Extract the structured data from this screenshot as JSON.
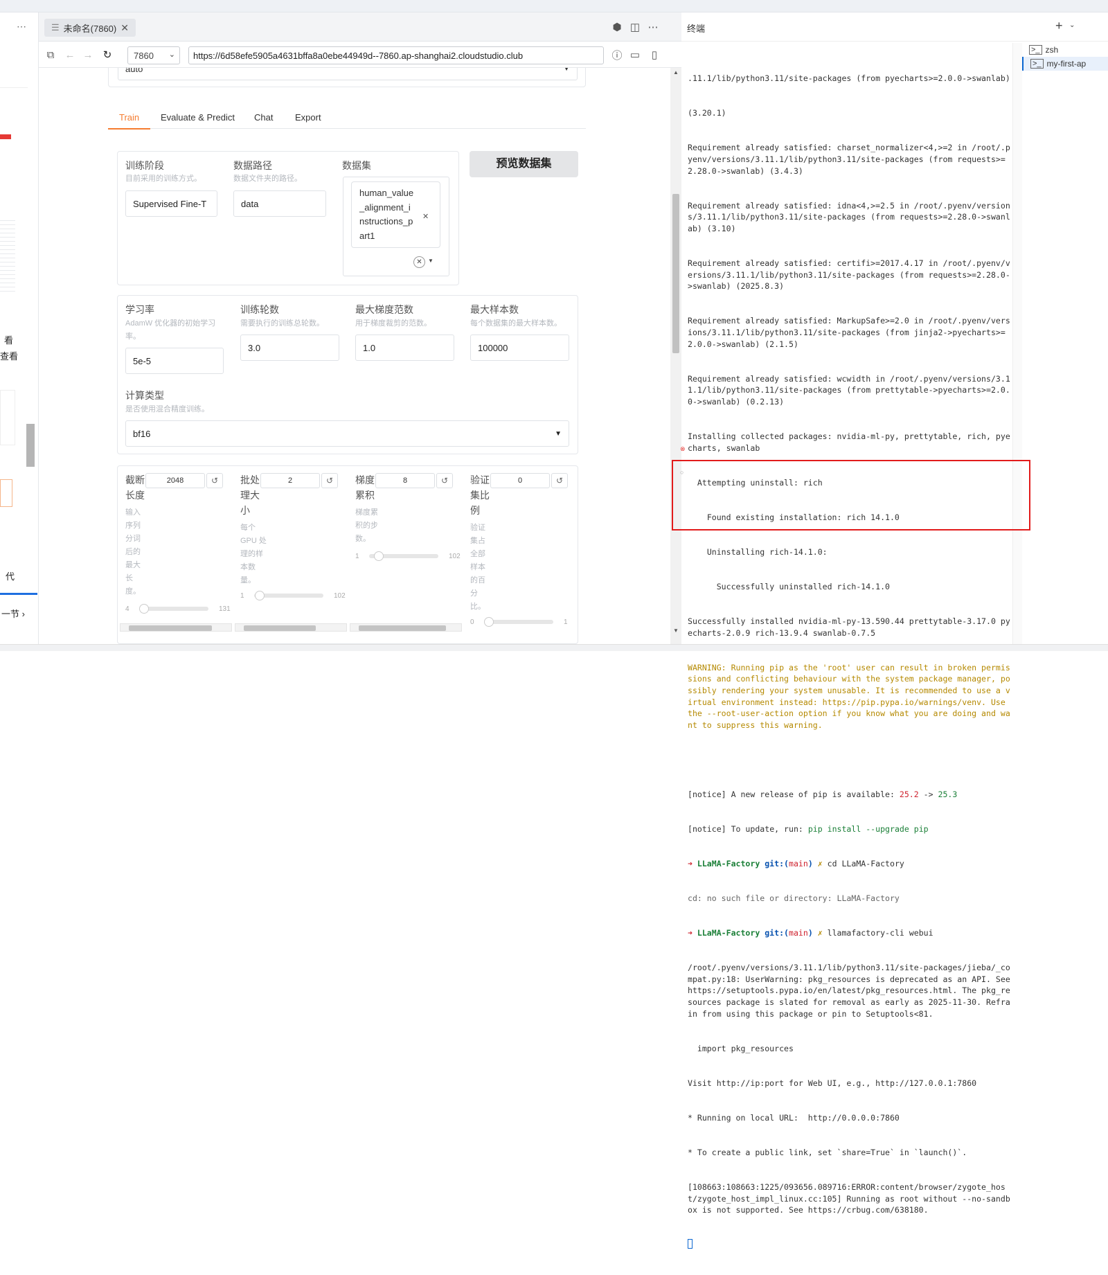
{
  "browser": {
    "tab_title": "未命名(7860)",
    "port": "7860",
    "url": "https://6d58efe5905a4631bffa8a0ebe44949d--7860.ap-shanghai2.cloudstudio.club"
  },
  "webui": {
    "top_select_value": "auto",
    "tabs": [
      "Train",
      "Evaluate & Predict",
      "Chat",
      "Export"
    ],
    "active_tab": "Train",
    "stage": {
      "label": "训练阶段",
      "hint": "目前采用的训练方式。",
      "value": "Supervised Fine-T"
    },
    "dataset_dir": {
      "label": "数据路径",
      "hint": "数据文件夹的路径。",
      "value": "data"
    },
    "dataset": {
      "label": "数据集",
      "chip": [
        "human_value",
        "_alignment_i",
        "nstructions_p",
        "art1"
      ]
    },
    "preview_button": "预览数据集",
    "learning_rate": {
      "label": "学习率",
      "hint": [
        "AdamW 优化器的初始学习",
        "率。"
      ],
      "value": "5e-5"
    },
    "epochs": {
      "label": "训练轮数",
      "hint": "需要执行的训练总轮数。",
      "value": "3.0"
    },
    "max_grad_norm": {
      "label": "最大梯度范数",
      "hint": "用于梯度裁剪的范数。",
      "value": "1.0"
    },
    "max_samples": {
      "label": "最大样本数",
      "hint": "每个数据集的最大样本数。",
      "value": "100000"
    },
    "compute_type": {
      "label": "计算类型",
      "hint": "是否使用混合精度训练。",
      "value": "bf16"
    },
    "cutoff_len": {
      "label": [
        "截断",
        "长度"
      ],
      "hint": [
        "输入",
        "序列",
        "分词",
        "后的",
        "最大",
        "长",
        "度。"
      ],
      "value": "2048",
      "min": "4",
      "max": "131",
      "level": 0.0
    },
    "batch_size": {
      "label": [
        "批处",
        "理大",
        "小"
      ],
      "hint": [
        "每个",
        "GPU 处",
        "理的样",
        "本数",
        "量。"
      ],
      "value": "2",
      "min": "1",
      "max": "102",
      "level": 0.01
    },
    "grad_accum": {
      "label": [
        "梯度",
        "累积"
      ],
      "hint": [
        "梯度累",
        "积的步",
        "数。"
      ],
      "value": "8",
      "min": "1",
      "max": "102",
      "level": 0.07
    },
    "val_size": {
      "label": [
        "验证",
        "集比",
        "例"
      ],
      "hint": [
        "验证",
        "集占",
        "全部",
        "样本",
        "的百",
        "分",
        "比。"
      ],
      "value": "0",
      "min": "0",
      "max": "1",
      "level": 0.0
    }
  },
  "left_panel": {
    "texts": [
      "看",
      "查看",
      "代",
      "一节 ›"
    ]
  },
  "terminal": {
    "title": "终端",
    "add": "+",
    "sessions": [
      "zsh",
      "my-first-ap"
    ],
    "lines": [
      ".11.1/lib/python3.11/site-packages (from pyecharts>=2.0.0->swanlab)",
      "(3.20.1)",
      "Requirement already satisfied: charset_normalizer<4,>=2 in /root/.pyenv/versions/3.11.1/lib/python3.11/site-packages (from requests>=2.28.0->swanlab) (3.4.3)",
      "Requirement already satisfied: idna<4,>=2.5 in /root/.pyenv/versions/3.11.1/lib/python3.11/site-packages (from requests>=2.28.0->swanlab) (3.10)",
      "Requirement already satisfied: certifi>=2017.4.17 in /root/.pyenv/versions/3.11.1/lib/python3.11/site-packages (from requests>=2.28.0->swanlab) (2025.8.3)",
      "Requirement already satisfied: MarkupSafe>=2.0 in /root/.pyenv/versions/3.11.1/lib/python3.11/site-packages (from jinja2->pyecharts>=2.0.0->swanlab) (2.1.5)",
      "Requirement already satisfied: wcwidth in /root/.pyenv/versions/3.11.1/lib/python3.11/site-packages (from prettytable->pyecharts>=2.0.0->swanlab) (0.2.13)",
      "Installing collected packages: nvidia-ml-py, prettytable, rich, pyecharts, swanlab",
      "  Attempting uninstall: rich",
      "    Found existing installation: rich 14.1.0",
      "    Uninstalling rich-14.1.0:",
      "      Successfully uninstalled rich-14.1.0",
      "Successfully installed nvidia-ml-py-13.590.44 prettytable-3.17.0 pyecharts-2.0.9 rich-13.9.4 swanlab-0.7.5"
    ],
    "warning": "WARNING: Running pip as the 'root' user can result in broken permissions and conflicting behaviour with the system package manager, possibly rendering your system unusable. It is recommended to use a virtual environment instead: https://pip.pypa.io/warnings/venv. Use the --root-user-action option if you know what you are doing and want to suppress this warning.",
    "notice1": {
      "tag": "[notice]",
      "text": " A new release of pip is available: ",
      "old": "25.2",
      "arrow": " -> ",
      "new": "25.3"
    },
    "notice2": {
      "tag": "[notice]",
      "text": " To update, run: ",
      "cmd": "pip install --upgrade pip"
    },
    "prompt1": {
      "arrow": "➜",
      "dir": " LLaMA-Factory",
      "git": " git:(",
      "branch": "main",
      "close": ")",
      "x": " ✗",
      "cmd": " cd LLaMA-Factory"
    },
    "error1": "cd: no such file or directory: LLaMA-Factory",
    "prompt2": {
      "arrow": "➜",
      "dir": " LLaMA-Factory",
      "git": " git:(",
      "branch": "main",
      "close": ")",
      "x": " ✗",
      "cmd": " llamafactory-cli webui"
    },
    "tail": "/root/.pyenv/versions/3.11.1/lib/python3.11/site-packages/jieba/_compat.py:18: UserWarning: pkg_resources is deprecated as an API. See https://setuptools.pypa.io/en/latest/pkg_resources.html. The pkg_resources package is slated for removal as early as 2025-11-30. Refrain from using this package or pin to Setuptools<81.",
    "tail2": [
      "  import pkg_resources",
      "Visit http://ip:port for Web UI, e.g., http://127.0.0.1:7860",
      "* Running on local URL:  http://0.0.0.0:7860",
      "* To create a public link, set `share=True` in `launch()`.",
      "[108663:108663:1225/093656.089716:ERROR:content/browser/zygote_host/zygote_host_impl_linux.cc:105] Running as root without --no-sandbox is not supported. See https://crbug.com/638180."
    ]
  },
  "colors": {
    "accent": "#f57c2f",
    "highlight_box": "#e21b1b",
    "prompt_green": "#1a7f37"
  }
}
